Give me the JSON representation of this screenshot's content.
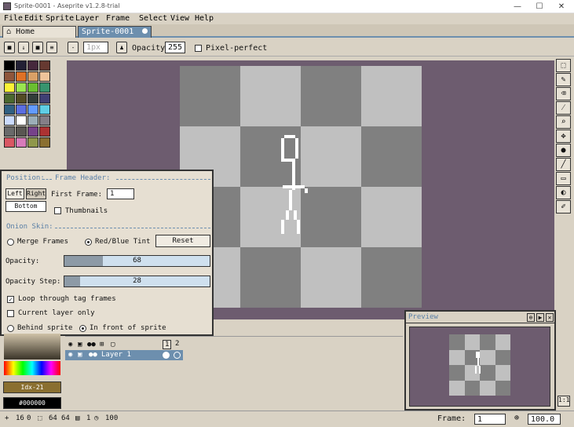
{
  "window": {
    "title": "Sprite-0001 - Aseprite v1.2.8-trial",
    "minimize": "—",
    "maximize": "☐",
    "close": "✕"
  },
  "menu": [
    "File",
    "Edit",
    "Sprite",
    "Layer",
    "Frame",
    "Select",
    "View",
    "Help"
  ],
  "tabs": [
    {
      "label": "Home"
    },
    {
      "label": "Sprite-0001"
    }
  ],
  "context_bar": {
    "zoom_value": "1px",
    "opacity_label": "Opacity:",
    "opacity_value": "255",
    "pixel_perfect": "Pixel-perfect"
  },
  "palette_colors": [
    "#000000",
    "#222034",
    "#45283c",
    "#663931",
    "#8f563b",
    "#df7126",
    "#d9a066",
    "#eec39a",
    "#fbf236",
    "#99e550",
    "#6abe30",
    "#37946e",
    "#4b692f",
    "#524b24",
    "#323c39",
    "#3f3f74",
    "#306082",
    "#5b6ee1",
    "#639bff",
    "#5fcde4",
    "#cbdbfc",
    "#ffffff",
    "#9badb7",
    "#847e87",
    "#696a6a",
    "#595652",
    "#76428a",
    "#ac3232",
    "#d95763",
    "#d77bba",
    "#8f974a",
    "#8a6f30"
  ],
  "onion": {
    "position_label": "Position:",
    "frame_header_label": "Frame Header:",
    "left": "Left",
    "right": "Right",
    "bottom": "Bottom",
    "first_frame_label": "First Frame:",
    "first_frame_value": "1",
    "thumbnails": "Thumbnails",
    "onion_skin_label": "Onion Skin:",
    "merge_frames": "Merge Frames",
    "red_blue_tint": "Red/Blue Tint",
    "reset": "Reset",
    "opacity_label": "Opacity:",
    "opacity_value": "68",
    "opacity_step_label": "Opacity Step:",
    "opacity_step_value": "28",
    "loop_tag": "Loop through tag frames",
    "current_layer": "Current layer only",
    "behind_sprite": "Behind sprite",
    "in_front": "In front of sprite"
  },
  "timeline": {
    "layer_name": "Layer 1",
    "frame1": "1",
    "frame2": "2"
  },
  "preview": {
    "title": "Preview"
  },
  "colors": {
    "fg_hex": "Idx-21",
    "bg_hex": "#000000"
  },
  "status": {
    "pos_x": "16",
    "pos_y": "0",
    "size_w": "64",
    "size_h": "64",
    "frames": "1",
    "zoom": "100",
    "frame_label": "Frame:",
    "frame_value": "1",
    "zoom_value": "100.0"
  }
}
